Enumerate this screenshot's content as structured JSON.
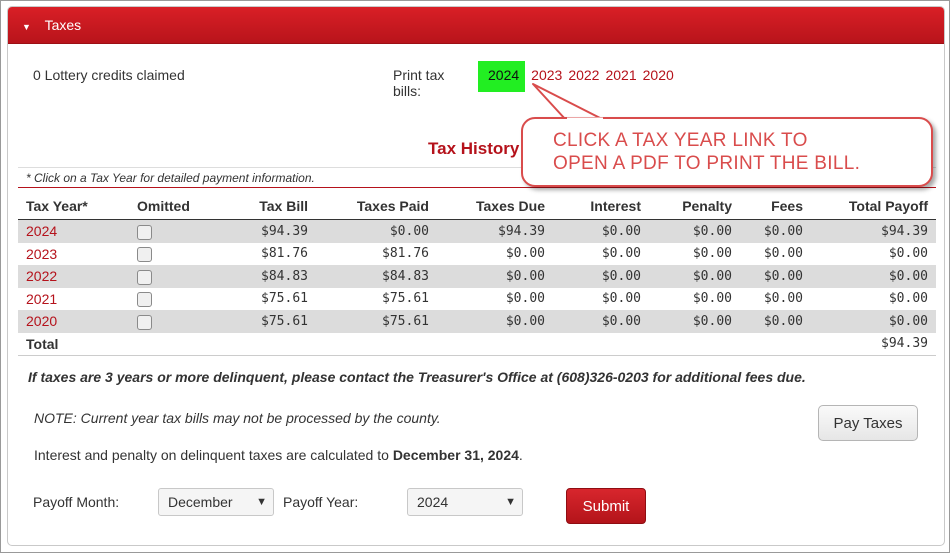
{
  "panel": {
    "title": "Taxes"
  },
  "lottery_text": "0 Lottery credits claimed",
  "print": {
    "label": "Print tax bills:",
    "years": [
      "2024",
      "2023",
      "2022",
      "2021",
      "2020"
    ],
    "highlighted": "2024"
  },
  "tax_history": {
    "title": "Tax History",
    "note": "* Click on a Tax Year for detailed payment information.",
    "columns": [
      "Tax Year*",
      "Omitted",
      "Tax Bill",
      "Taxes Paid",
      "Taxes Due",
      "Interest",
      "Penalty",
      "Fees",
      "Total Payoff"
    ],
    "rows": [
      {
        "year": "2024",
        "omitted": false,
        "tax_bill": "$94.39",
        "taxes_paid": "$0.00",
        "taxes_due": "$94.39",
        "interest": "$0.00",
        "penalty": "$0.00",
        "fees": "$0.00",
        "total_payoff": "$94.39"
      },
      {
        "year": "2023",
        "omitted": false,
        "tax_bill": "$81.76",
        "taxes_paid": "$81.76",
        "taxes_due": "$0.00",
        "interest": "$0.00",
        "penalty": "$0.00",
        "fees": "$0.00",
        "total_payoff": "$0.00"
      },
      {
        "year": "2022",
        "omitted": false,
        "tax_bill": "$84.83",
        "taxes_paid": "$84.83",
        "taxes_due": "$0.00",
        "interest": "$0.00",
        "penalty": "$0.00",
        "fees": "$0.00",
        "total_payoff": "$0.00"
      },
      {
        "year": "2021",
        "omitted": false,
        "tax_bill": "$75.61",
        "taxes_paid": "$75.61",
        "taxes_due": "$0.00",
        "interest": "$0.00",
        "penalty": "$0.00",
        "fees": "$0.00",
        "total_payoff": "$0.00"
      },
      {
        "year": "2020",
        "omitted": false,
        "tax_bill": "$75.61",
        "taxes_paid": "$75.61",
        "taxes_due": "$0.00",
        "interest": "$0.00",
        "penalty": "$0.00",
        "fees": "$0.00",
        "total_payoff": "$0.00"
      }
    ],
    "total_label": "Total",
    "total_value": "$94.39"
  },
  "delinquent_note": "If taxes are 3 years or more delinquent, please contact the Treasurer's Office at (608)326-0203 for additional fees due.",
  "current_year_note": "NOTE: Current year tax bills may not be processed by the county.",
  "interest_note": {
    "prefix": "Interest and penalty on delinquent taxes are calculated to ",
    "date": "December 31, 2024",
    "suffix": "."
  },
  "pay_taxes_label": "Pay Taxes",
  "payoff": {
    "month_label": "Payoff Month:",
    "month_value": "December",
    "year_label": "Payoff Year:",
    "year_value": "2024",
    "submit_label": "Submit"
  },
  "callout": {
    "line1": "CLICK A TAX YEAR LINK TO",
    "line2": "OPEN A PDF TO PRINT THE BILL."
  },
  "colors": {
    "brand_red": "#b5121b",
    "highlight_green": "#22ee22",
    "callout_red": "#d94c4c"
  },
  "icons": {
    "panel_toggle": "caret-down-icon",
    "select_chevron": "chevron-down-icon"
  }
}
